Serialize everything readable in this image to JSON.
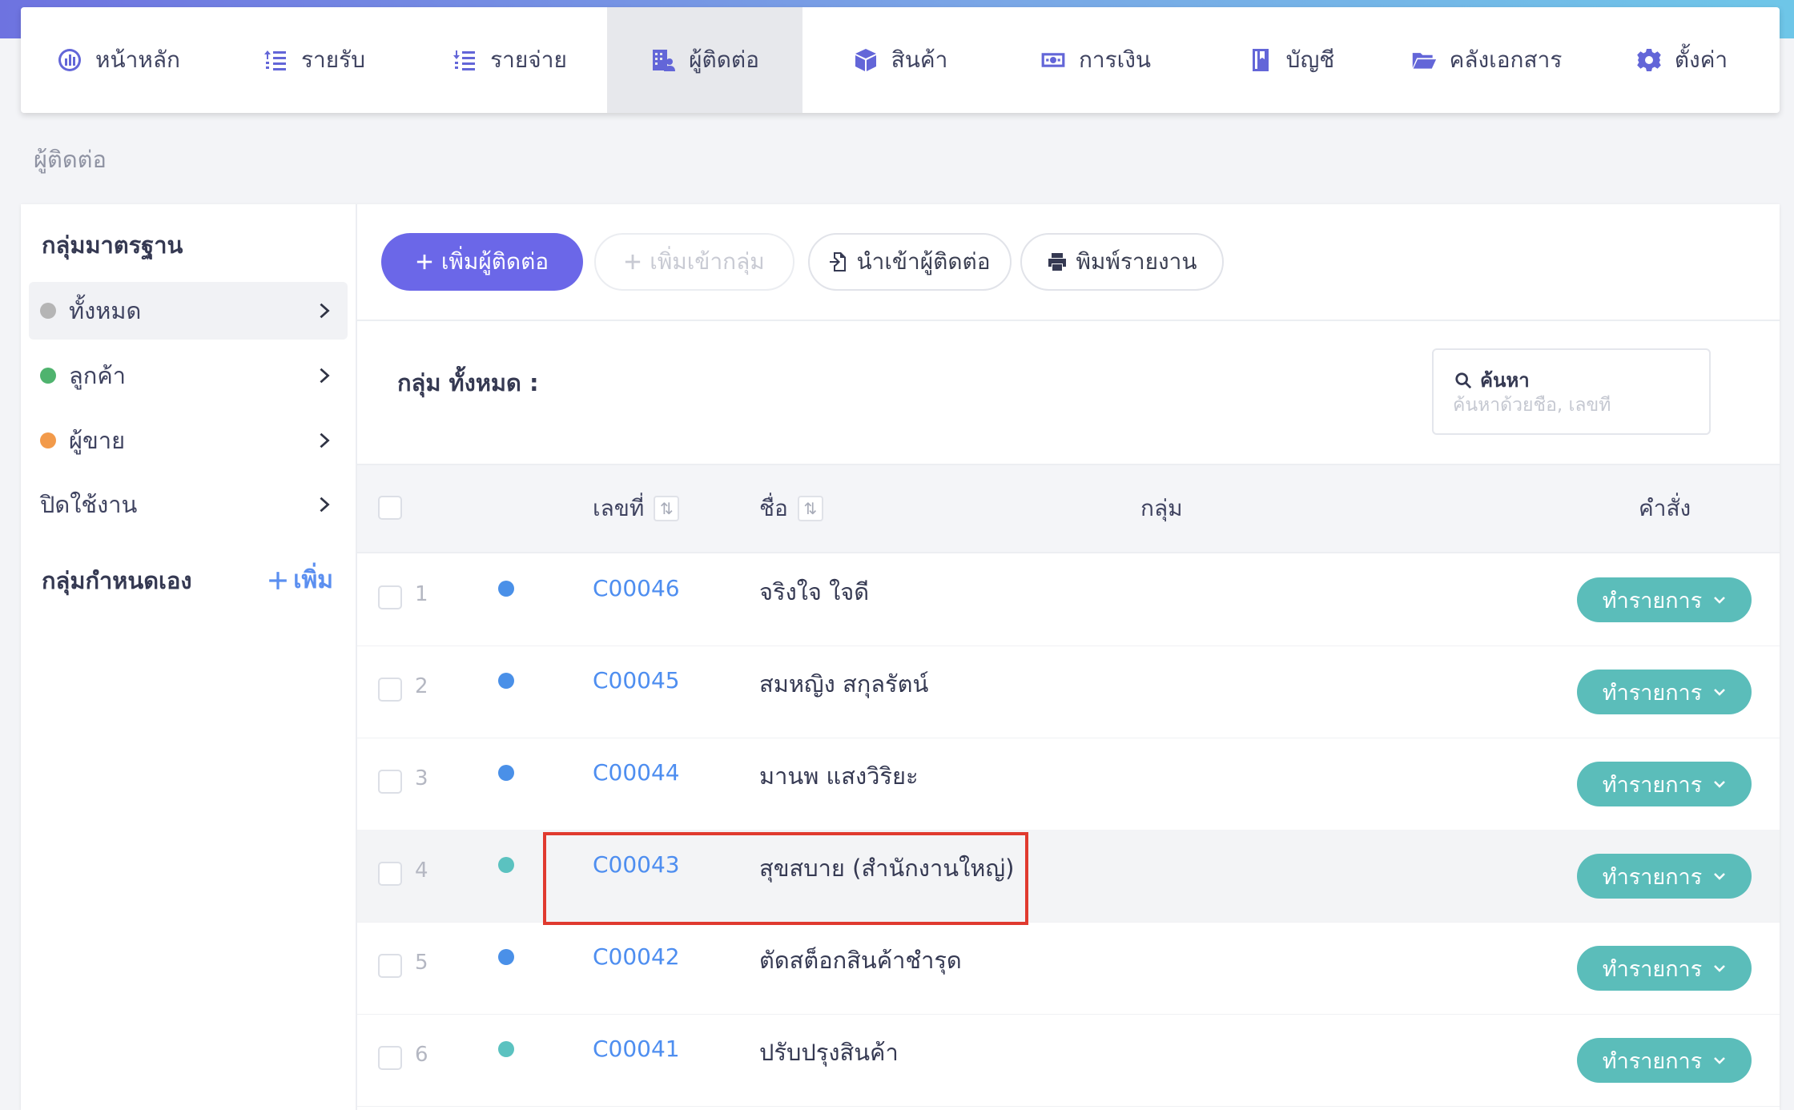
{
  "nav": {
    "items": [
      {
        "label": "หน้าหลัก",
        "icon": "dashboard-icon"
      },
      {
        "label": "รายรับ",
        "icon": "income-list-icon"
      },
      {
        "label": "รายจ่าย",
        "icon": "expense-list-icon"
      },
      {
        "label": "ผู้ติดต่อ",
        "icon": "contacts-icon",
        "active": true
      },
      {
        "label": "สินค้า",
        "icon": "box-icon"
      },
      {
        "label": "การเงิน",
        "icon": "money-icon"
      },
      {
        "label": "บัญชี",
        "icon": "book-icon"
      },
      {
        "label": "คลังเอกสาร",
        "icon": "folder-icon"
      },
      {
        "label": "ตั้งค่า",
        "icon": "gear-icon"
      }
    ]
  },
  "breadcrumb": "ผู้ติดต่อ",
  "sidebar": {
    "standard_title": "กลุ่มมาตรฐาน",
    "items": [
      {
        "label": "ทั้งหมด",
        "dot_color": "#b5b5b5"
      },
      {
        "label": "ลูกค้า",
        "dot_color": "#4fb36e"
      },
      {
        "label": "ผู้ขาย",
        "dot_color": "#f29a4a"
      },
      {
        "label": "ปิดใช้งาน"
      }
    ],
    "custom_title": "กลุ่มกำหนดเอง",
    "add_label": "เพิ่ม"
  },
  "toolbar": {
    "add_contact": "เพิ่มผู้ติดต่อ",
    "add_to_group": "เพิ่มเข้ากลุ่ม",
    "import_contacts": "นำเข้าผู้ติดต่อ",
    "print_report": "พิมพ์รายงาน"
  },
  "group_title": "กลุ่ม ทั้งหมด :",
  "search": {
    "label": "ค้นหา",
    "placeholder": "ค้นหาด้วยชื่อ, เลขที่"
  },
  "table": {
    "headers": {
      "code": "เลขที่",
      "name": "ชื่อ",
      "group": "กลุ่ม",
      "action": "คำสั่ง"
    },
    "action_label": "ทำรายการ",
    "rows": [
      {
        "index": "1",
        "code": "C00046",
        "name": "จริงใจ ใจดี",
        "dot_color": "#4a90e8"
      },
      {
        "index": "2",
        "code": "C00045",
        "name": "สมหญิง สกุลรัตน์",
        "dot_color": "#4a90e8"
      },
      {
        "index": "3",
        "code": "C00044",
        "name": "มานพ แสงวิริยะ",
        "dot_color": "#4a90e8"
      },
      {
        "index": "4",
        "code": "C00043",
        "name": "สุขสบาย (สำนักงานใหญ่)",
        "dot_color": "#5bc2c0"
      },
      {
        "index": "5",
        "code": "C00042",
        "name": "ตัดสต็อกสินค้าชำรุด",
        "dot_color": "#4a90e8"
      },
      {
        "index": "6",
        "code": "C00041",
        "name": "ปรับปรุงสินค้า",
        "dot_color": "#5bc2c0"
      }
    ]
  },
  "colors": {
    "primary": "#6b67e8",
    "link": "#4e8ef0",
    "action": "#5bbdba",
    "highlight": "#e03a2f"
  }
}
